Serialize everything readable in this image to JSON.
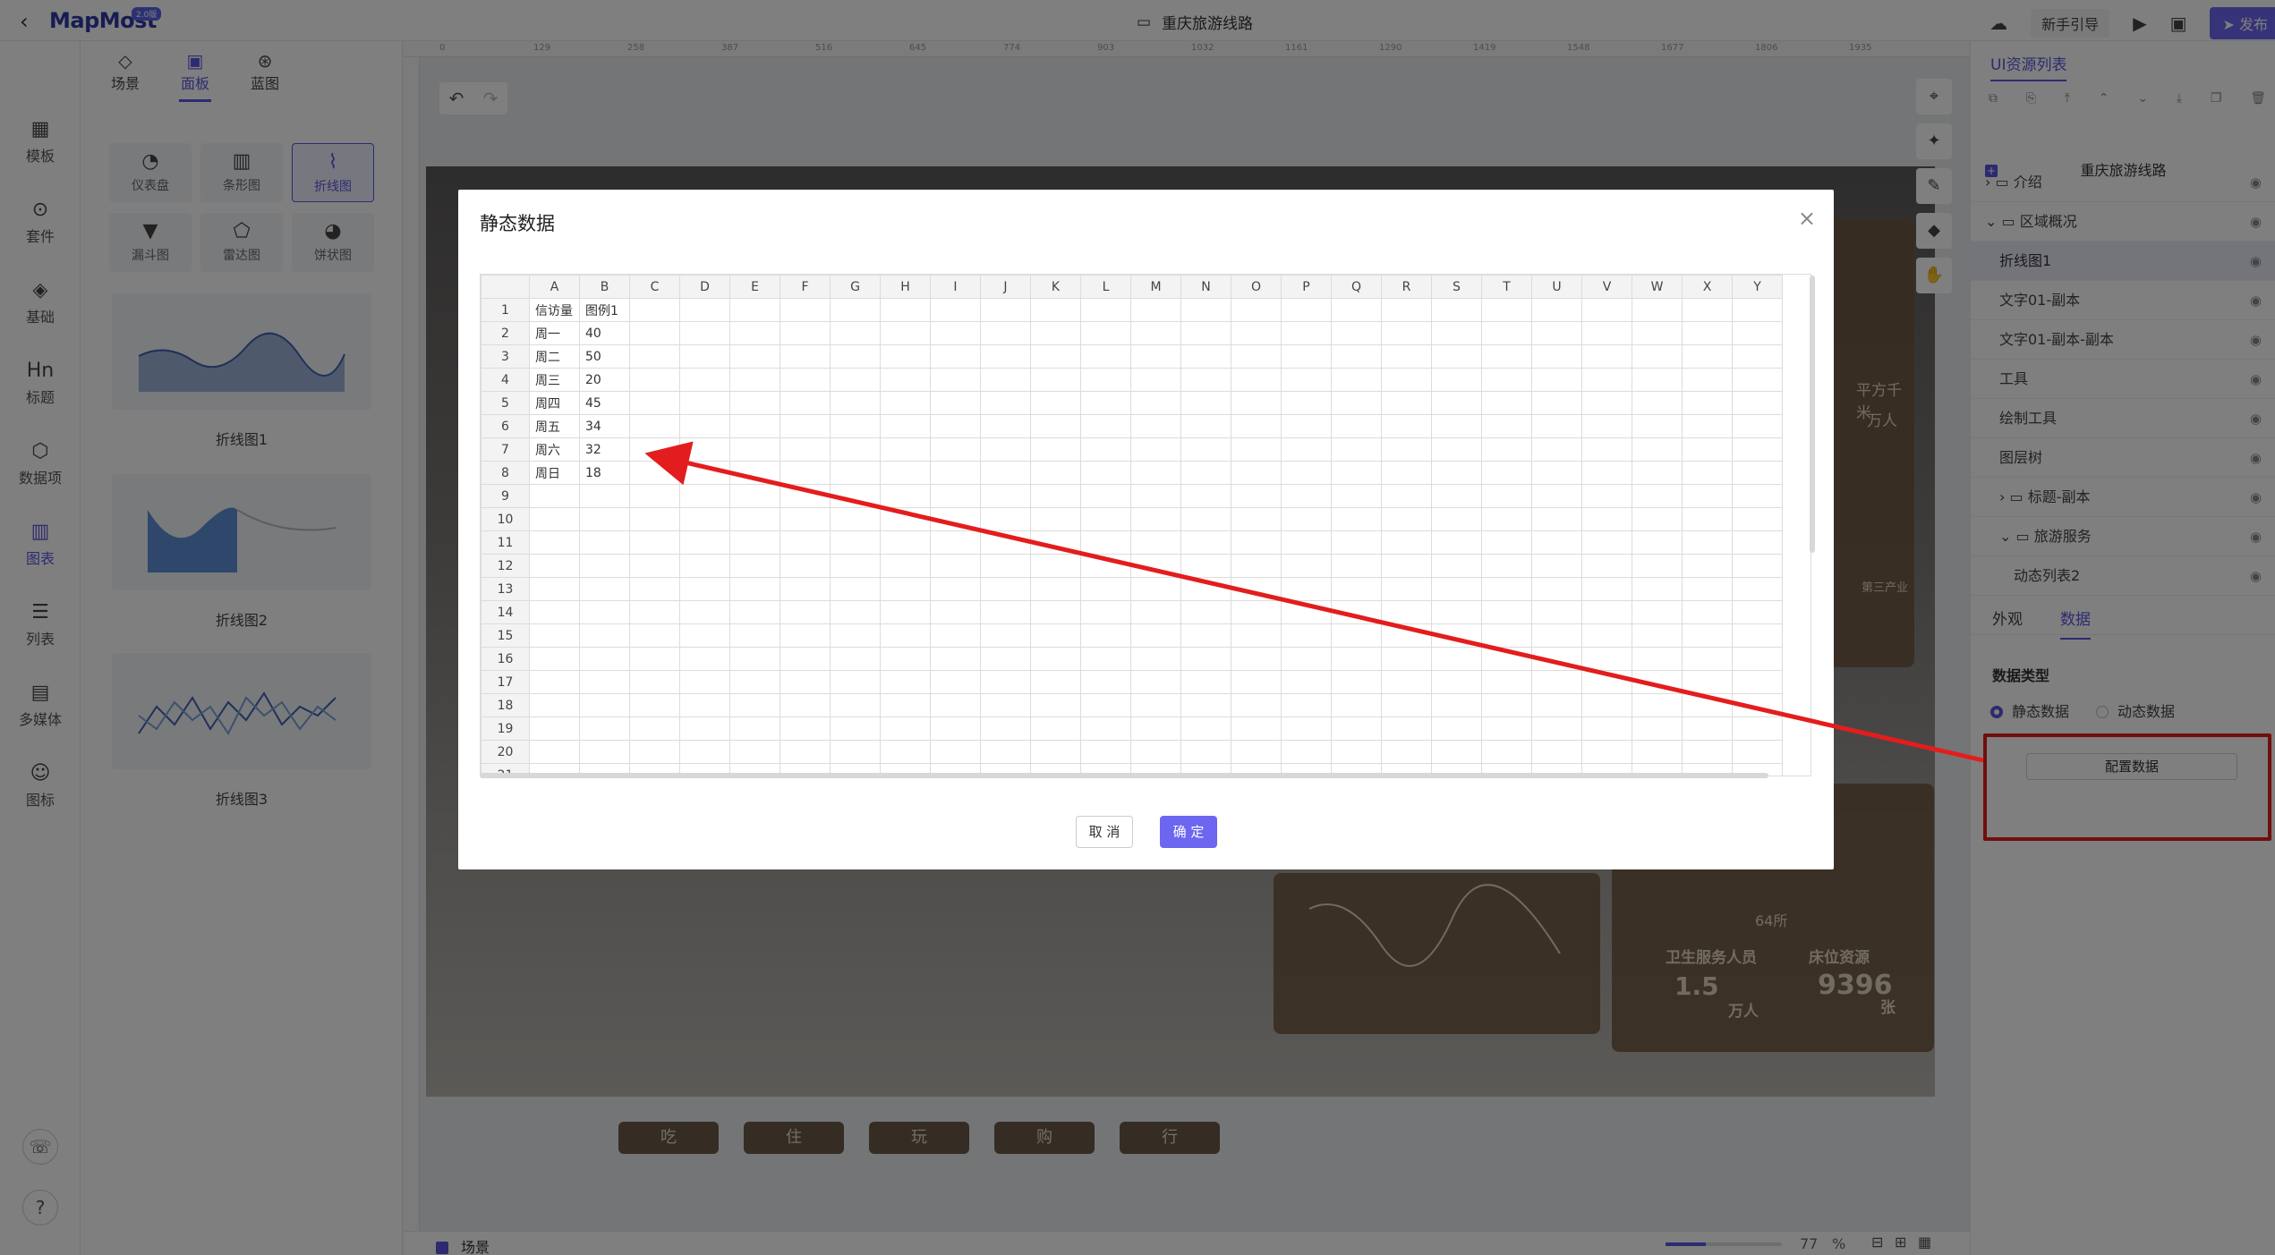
{
  "topbar": {
    "logo": "MapMost",
    "logo_badge": "2.0版",
    "project_title": "重庆旅游线路",
    "guide_label": "新手引导",
    "publish_label": "发布"
  },
  "left_rail": {
    "items": [
      "模板",
      "套件",
      "基础",
      "标题",
      "数据项",
      "图表",
      "列表",
      "多媒体",
      "图标"
    ]
  },
  "panel": {
    "tabs": [
      "场景",
      "面板",
      "蓝图"
    ],
    "chart_types": [
      "仪表盘",
      "条形图",
      "折线图",
      "漏斗图",
      "雷达图",
      "饼状图"
    ],
    "thumbnails": [
      "折线图1",
      "折线图2",
      "折线图3"
    ]
  },
  "canvas": {
    "ruler_ticks": [
      "0",
      "129",
      "258",
      "387",
      "516",
      "645",
      "774",
      "903",
      "1032",
      "1161",
      "1290",
      "1419",
      "1548",
      "1677",
      "1806",
      "1935"
    ],
    "category_buttons": [
      "吃",
      "住",
      "玩",
      "购",
      "行"
    ],
    "card_texts": {
      "area": "平方千米",
      "people": "万人",
      "third_industry": "第三产业",
      "schools": "64所",
      "health_staff": "卫生服务人员",
      "bed_resources": "床位资源",
      "health_value": "1.5",
      "bed_value": "9396",
      "health_unit": "万人",
      "bed_unit": "张"
    }
  },
  "bottombar": {
    "scene_label": "场景",
    "zoom": "77",
    "zoom_unit": "%"
  },
  "right_panel": {
    "title": "UI资源列表",
    "tree_title": "重庆旅游线路",
    "tree": [
      {
        "label": "介绍",
        "indent": 0,
        "prefix": "› ▭"
      },
      {
        "label": "区域概况",
        "indent": 0,
        "prefix": "⌄ ▭"
      },
      {
        "label": "折线图1",
        "indent": 1,
        "prefix": ""
      },
      {
        "label": "文字01-副本",
        "indent": 1,
        "prefix": ""
      },
      {
        "label": "文字01-副本-副本",
        "indent": 1,
        "prefix": ""
      },
      {
        "label": "工具",
        "indent": 1,
        "prefix": ""
      },
      {
        "label": "绘制工具",
        "indent": 1,
        "prefix": ""
      },
      {
        "label": "图层树",
        "indent": 1,
        "prefix": ""
      },
      {
        "label": "标题-副本",
        "indent": 1,
        "prefix": "› ▭"
      },
      {
        "label": "旅游服务",
        "indent": 1,
        "prefix": "⌄ ▭"
      },
      {
        "label": "动态列表2",
        "indent": 2,
        "prefix": ""
      }
    ],
    "prop_tabs": [
      "外观",
      "数据"
    ],
    "data_type_label": "数据类型",
    "static_label": "静态数据",
    "dynamic_label": "动态数据",
    "config_button": "配置数据"
  },
  "modal": {
    "title": "静态数据",
    "columns": [
      "A",
      "B",
      "C",
      "D",
      "E",
      "F",
      "G",
      "H",
      "I",
      "J",
      "K",
      "L",
      "M",
      "N",
      "O",
      "P",
      "Q",
      "R",
      "S",
      "T",
      "U",
      "V",
      "W",
      "X",
      "Y"
    ],
    "rows": [
      [
        "信访量",
        "图例1"
      ],
      [
        "周一",
        "40"
      ],
      [
        "周二",
        "50"
      ],
      [
        "周三",
        "20"
      ],
      [
        "周四",
        "45"
      ],
      [
        "周五",
        "34"
      ],
      [
        "周六",
        "32"
      ],
      [
        "周日",
        "18"
      ],
      [],
      [],
      [],
      [],
      [],
      [],
      [],
      [],
      [],
      [],
      [],
      [],
      []
    ],
    "cancel_label": "取 消",
    "ok_label": "确 定"
  }
}
